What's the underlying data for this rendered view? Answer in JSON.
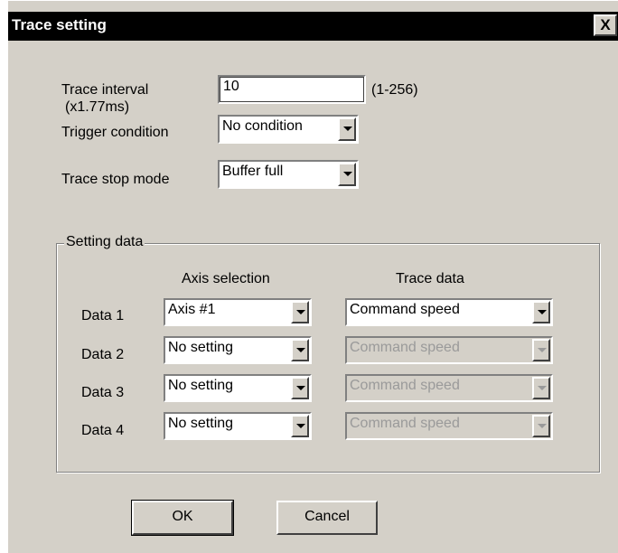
{
  "window": {
    "title": "Trace setting",
    "close_glyph": "X"
  },
  "trace_interval": {
    "label": "Trace interval",
    "sublabel": "(x1.77ms)",
    "value": "10",
    "range": "(1-256)"
  },
  "trigger_condition": {
    "label": "Trigger condition",
    "value": "No condition"
  },
  "trace_stop_mode": {
    "label": "Trace stop mode",
    "value": "Buffer full"
  },
  "setting_data": {
    "group_title": "Setting data",
    "col_axis": "Axis selection",
    "col_trace": "Trace data",
    "rows": [
      {
        "label": "Data 1",
        "axis": "Axis #1",
        "trace": "Command speed"
      },
      {
        "label": "Data 2",
        "axis": "No setting",
        "trace": "Command speed"
      },
      {
        "label": "Data 3",
        "axis": "No setting",
        "trace": "Command speed"
      },
      {
        "label": "Data 4",
        "axis": "No setting",
        "trace": "Command speed"
      }
    ]
  },
  "buttons": {
    "ok": "OK",
    "cancel": "Cancel"
  },
  "colors": {
    "dialog_bg": "#d4d0c8",
    "titlebar": "#000000",
    "disabled_text": "#9a9a9a"
  }
}
